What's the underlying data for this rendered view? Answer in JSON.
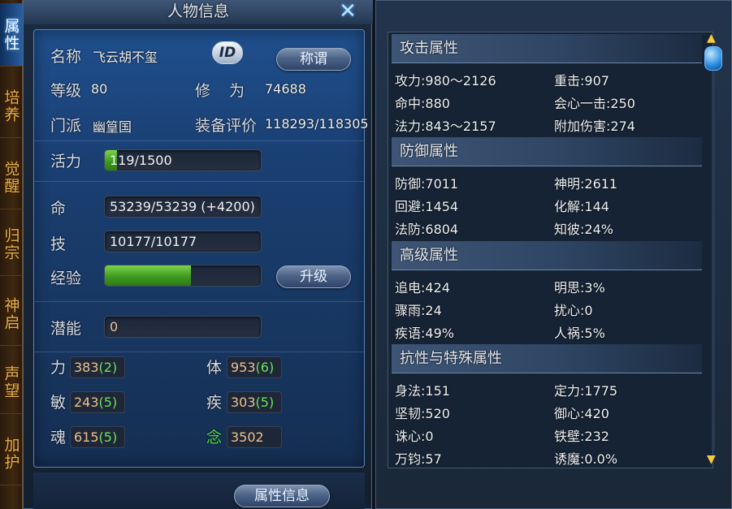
{
  "side_tabs": [
    "属性",
    "培养",
    "觉醒",
    "归宗",
    "神启",
    "声望",
    "加护"
  ],
  "active_tab": "属性",
  "window": {
    "title": "人物信息",
    "close_icon": "✕"
  },
  "basic": {
    "name_label": "名称",
    "name_value": "飞云胡不玺",
    "id_button": "ID",
    "title_button": "称谓",
    "level_label": "等级",
    "level_value": "80",
    "cultivation_label": "修　为",
    "cultivation_value": "74688",
    "faction_label": "门派",
    "faction_value": "幽篁国",
    "equip_rating_label": "装备评价",
    "equip_rating_value": "118293/118305"
  },
  "vitality": {
    "label": "活力",
    "value": "119/1500",
    "fraction": 0.079
  },
  "life": {
    "label": "命",
    "value": "53239/53239 (+4200)"
  },
  "skill": {
    "label": "技",
    "value": "10177/10177"
  },
  "experience": {
    "label": "经验",
    "fraction": 0.55,
    "upgrade_button": "升级"
  },
  "potential": {
    "label": "潜能",
    "value": "0"
  },
  "stats": [
    {
      "label": "力",
      "base": "383",
      "bonus": "(2)"
    },
    {
      "label": "体",
      "base": "953",
      "bonus": "(6)"
    },
    {
      "label": "敏",
      "base": "243",
      "bonus": "(5)"
    },
    {
      "label": "疾",
      "base": "303",
      "bonus": "(5)"
    },
    {
      "label": "魂",
      "base": "615",
      "bonus": "(5)"
    },
    {
      "label": "念",
      "base": "3502",
      "bonus": ""
    }
  ],
  "attr_info_button": "属性信息",
  "attributes": {
    "attack": {
      "header": "攻击属性",
      "items": [
        "攻力:980～2126",
        "重击:907",
        "命中:880",
        "会心一击:250",
        "法力:843～2157",
        "附加伤害:274"
      ]
    },
    "defense": {
      "header": "防御属性",
      "items": [
        "防御:7011",
        "神明:2611",
        "回避:1454",
        "化解:144",
        "法防:6804",
        "知彼:24%"
      ]
    },
    "advanced": {
      "header": "高级属性",
      "items": [
        "追电:424",
        "明思:3%",
        "骤雨:24",
        "扰心:0",
        "疾语:49%",
        "人祸:5%"
      ]
    },
    "resist": {
      "header": "抗性与特殊属性",
      "items": [
        "身法:151",
        "定力:1775",
        "坚韧:520",
        "御心:420",
        "诛心:0",
        "铁壁:232",
        "万钧:57",
        "诱魔:0.0%"
      ]
    }
  },
  "scroll": {
    "up_icon": "▲",
    "down_icon": "▼"
  },
  "colors": {
    "accent_blue": "#1f4f8d",
    "stat_base": "#eec08c",
    "stat_bonus": "#6fe15a",
    "tab_gold": "#e8b04a",
    "bar_green": "#4fb22a"
  }
}
